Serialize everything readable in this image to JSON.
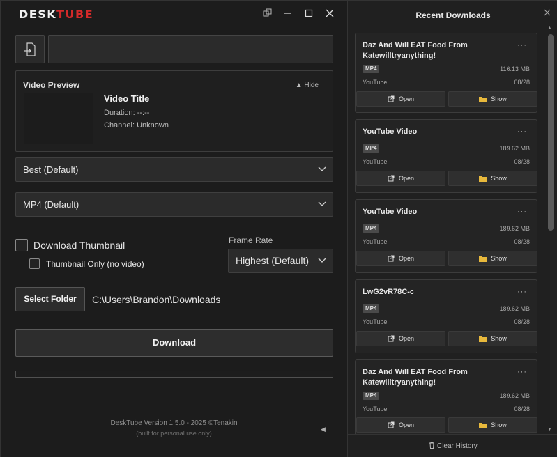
{
  "app": {
    "logo_main": "DESK",
    "logo_accent": "TUBE",
    "accent_color": "#d32a2a"
  },
  "url_input": {
    "value": "",
    "placeholder": ""
  },
  "preview": {
    "heading": "Video Preview",
    "hide_label": "Hide",
    "video_title": "Video Title",
    "duration": "Duration: --:--",
    "channel": "Channel: Unknown"
  },
  "quality_select": {
    "selected": "Best (Default)"
  },
  "format_select": {
    "selected": "MP4 (Default)"
  },
  "options": {
    "download_thumbnail": "Download Thumbnail",
    "thumbnail_only": "Thumbnail Only (no video)"
  },
  "frame_rate": {
    "label": "Frame Rate",
    "selected": "Highest (Default)"
  },
  "folder": {
    "button": "Select Folder",
    "path": "C:\\Users\\Brandon\\Downloads"
  },
  "download_button": "Download",
  "progress": {
    "percent": 0
  },
  "footer": {
    "version": "DeskTube Version 1.5.0 - 2025 ©Tenakin",
    "note": "(built for personal use only)"
  },
  "recent": {
    "title": "Recent Downloads",
    "clear_history": "Clear History",
    "open_label": "Open",
    "show_label": "Show",
    "items": [
      {
        "title": "Daz And Will EAT Food From Katewilltryanything!",
        "format": "MP4",
        "size": "116.13 MB",
        "source": "YouTube",
        "date": "08/28"
      },
      {
        "title": "YouTube Video",
        "format": "MP4",
        "size": "189.62 MB",
        "source": "YouTube",
        "date": "08/28"
      },
      {
        "title": "YouTube Video",
        "format": "MP4",
        "size": "189.62 MB",
        "source": "YouTube",
        "date": "08/28"
      },
      {
        "title": "LwG2vR78C-c",
        "format": "MP4",
        "size": "189.62 MB",
        "source": "YouTube",
        "date": "08/28"
      },
      {
        "title": "Daz And Will EAT Food From Katewilltryanything!",
        "format": "MP4",
        "size": "189.62 MB",
        "source": "YouTube",
        "date": "08/28"
      }
    ]
  }
}
